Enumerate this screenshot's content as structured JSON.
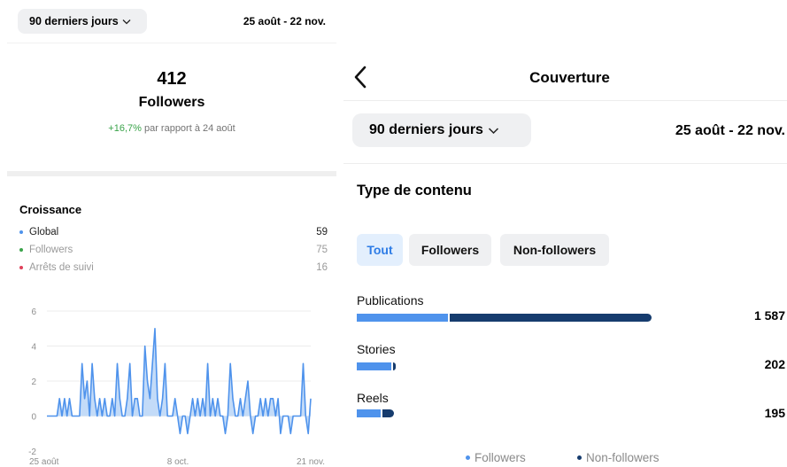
{
  "left": {
    "range_label": "90 derniers jours",
    "date_range": "25 août - 22 nov.",
    "followers_count": "412",
    "followers_label": "Followers",
    "delta_percent": "+16,7%",
    "delta_suffix": " par rapport à 24 août",
    "growth_title": "Croissance",
    "legend": [
      {
        "label": "Global",
        "value": "59",
        "color": "#4f93ec"
      },
      {
        "label": "Followers",
        "value": "75",
        "color": "#3aa34a"
      },
      {
        "label": "Arrêts de suivi",
        "value": "16",
        "color": "#e0415a"
      }
    ],
    "icons": {
      "range_chevron": "chevron-down-icon"
    }
  },
  "chart_data": {
    "type": "area",
    "title": "",
    "xlabel": "",
    "ylabel": "",
    "ylim": [
      -2,
      6
    ],
    "y_ticks": [
      "6",
      "4",
      "2",
      "0",
      "-2"
    ],
    "x_tick_labels": [
      "25 août",
      "8 oct.",
      "21 nov."
    ],
    "series": [
      {
        "name": "Global",
        "values": [
          0,
          0,
          0,
          0,
          0,
          1,
          0,
          1,
          0,
          1,
          0,
          0,
          0,
          0,
          3,
          1,
          2,
          0,
          3,
          1,
          0,
          1,
          0,
          1,
          0,
          0,
          1,
          0,
          3,
          1,
          0,
          0,
          1,
          3,
          0,
          1,
          1,
          0,
          0,
          4,
          2,
          1,
          3,
          5,
          1,
          0,
          1,
          3,
          0,
          0,
          0,
          1,
          0,
          -1,
          0,
          0,
          -1,
          0,
          1,
          0,
          1,
          0,
          1,
          0,
          3,
          0,
          1,
          0,
          1,
          0,
          0,
          -1,
          0,
          3,
          1,
          0,
          0,
          1,
          0,
          1,
          2,
          0,
          -1,
          0,
          0,
          1,
          0,
          1,
          0,
          1,
          1,
          0,
          1,
          -1,
          0,
          0,
          0,
          -1,
          0,
          0,
          0,
          0,
          3,
          0,
          -1,
          1
        ],
        "color": "#4f93ec"
      }
    ]
  },
  "right": {
    "title": "Couverture",
    "range_label": "90 derniers jours",
    "date_range": "25 août - 22 nov.",
    "section_title": "Type de contenu",
    "filters": [
      "Tout",
      "Followers",
      "Non-followers"
    ],
    "active_filter": "Tout",
    "categories": [
      {
        "label": "Publications",
        "value": "1 587",
        "followers_share": 0.31
      },
      {
        "label": "Stories",
        "value": "202",
        "followers_share": 0.91
      },
      {
        "label": "Reels",
        "value": "195",
        "followers_share": 0.64
      }
    ],
    "legend": [
      {
        "label": "Followers",
        "color": "#4f93ec"
      },
      {
        "label": "Non-followers",
        "color": "#163c6e"
      }
    ],
    "icons": {
      "back": "chevron-left-icon",
      "range_chevron": "chevron-down-icon"
    }
  }
}
